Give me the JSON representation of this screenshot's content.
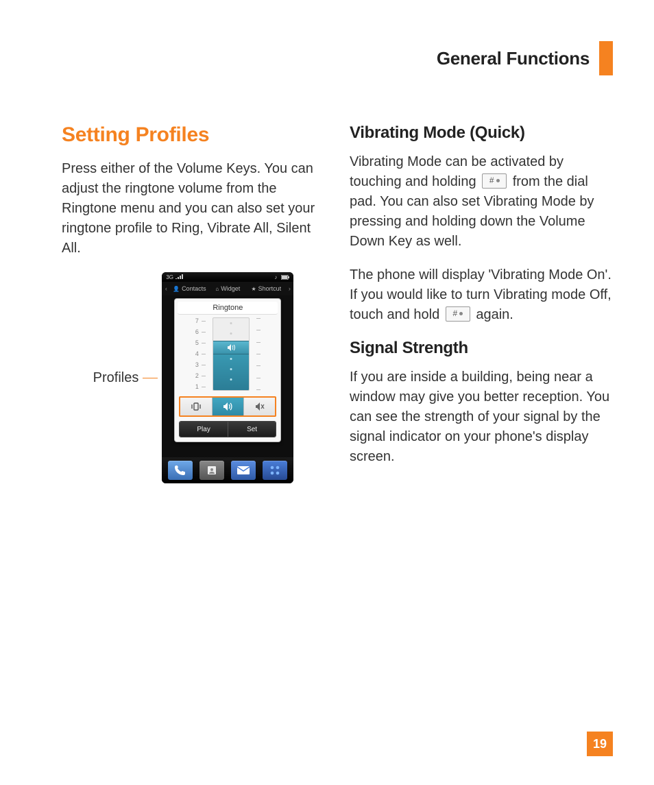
{
  "header": {
    "section": "General Functions"
  },
  "page_number": "19",
  "left": {
    "title": "Setting Profiles",
    "para1": "Press either of the Volume Keys. You can adjust the ringtone volume from the Ringtone menu and you can also set your ringtone profile to Ring, Vibrate All, Silent All.",
    "figure_label": "Profiles"
  },
  "right": {
    "h1": "Vibrating Mode (Quick)",
    "p1a": "Vibrating Mode can be activated by touching and holding ",
    "p1b": " from the dial pad. You can also set Vibrating Mode by pressing and holding down the Volume Down Key as well.",
    "p2a": "The phone will display 'Vibrating Mode On'. If you would like to turn Vibrating mode Off, touch and hold ",
    "p2b": " again.",
    "h2": "Signal Strength",
    "p3": "If you are inside a building, being near a window may give you better reception. You can see the strength of your signal by the signal indicator on your phone's display screen."
  },
  "phone": {
    "network_label": "3G",
    "homerow": {
      "contacts": "Contacts",
      "widget": "Widget",
      "shortcut": "Shortcut"
    },
    "panel_title": "Ringtone",
    "ticks": [
      "7",
      "6",
      "5",
      "4",
      "3",
      "2",
      "1"
    ],
    "current_level": 4,
    "profiles": {
      "items": [
        "vibrate",
        "ring",
        "silent"
      ],
      "active_index": 1
    },
    "actions": {
      "play": "Play",
      "set": "Set"
    },
    "dock": [
      "phone",
      "contacts",
      "messaging",
      "menu"
    ]
  },
  "icons": {
    "hash_key": "# ∘"
  }
}
